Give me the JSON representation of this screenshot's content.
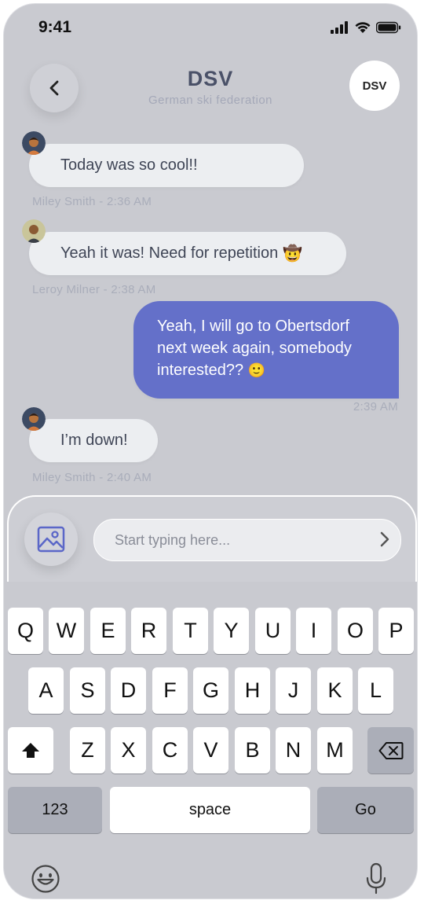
{
  "status_bar": {
    "time": "9:41"
  },
  "header": {
    "title": "DSV",
    "subtitle": "German ski federation",
    "badge": "DSV"
  },
  "messages": [
    {
      "text": "Today was so cool!!",
      "meta": "Miley Smith - 2:36 AM"
    },
    {
      "text": "Yeah it was! Need for repetition",
      "emoji": "🤠",
      "meta": "Leroy Milner - 2:38 AM"
    },
    {
      "text": "Yeah, I will go to Obertsdorf next week again, somebody interested??",
      "emoji": "🙂",
      "meta": "2:39 AM"
    },
    {
      "text": "I’m down!",
      "meta": "Miley Smith - 2:40 AM"
    }
  ],
  "composer": {
    "placeholder": "Start typing here..."
  },
  "keyboard": {
    "row1": [
      "Q",
      "W",
      "E",
      "R",
      "T",
      "Y",
      "U",
      "I",
      "O",
      "P"
    ],
    "row2": [
      "A",
      "S",
      "D",
      "F",
      "G",
      "H",
      "J",
      "K",
      "L"
    ],
    "row3": [
      "Z",
      "X",
      "C",
      "V",
      "B",
      "N",
      "M"
    ],
    "numbers": "123",
    "space": "space",
    "go": "Go"
  },
  "colors": {
    "background": "#c9cad0",
    "sent_bubble": "#6470c9",
    "received_bubble": "#eceef1",
    "title": "#4a5168"
  }
}
